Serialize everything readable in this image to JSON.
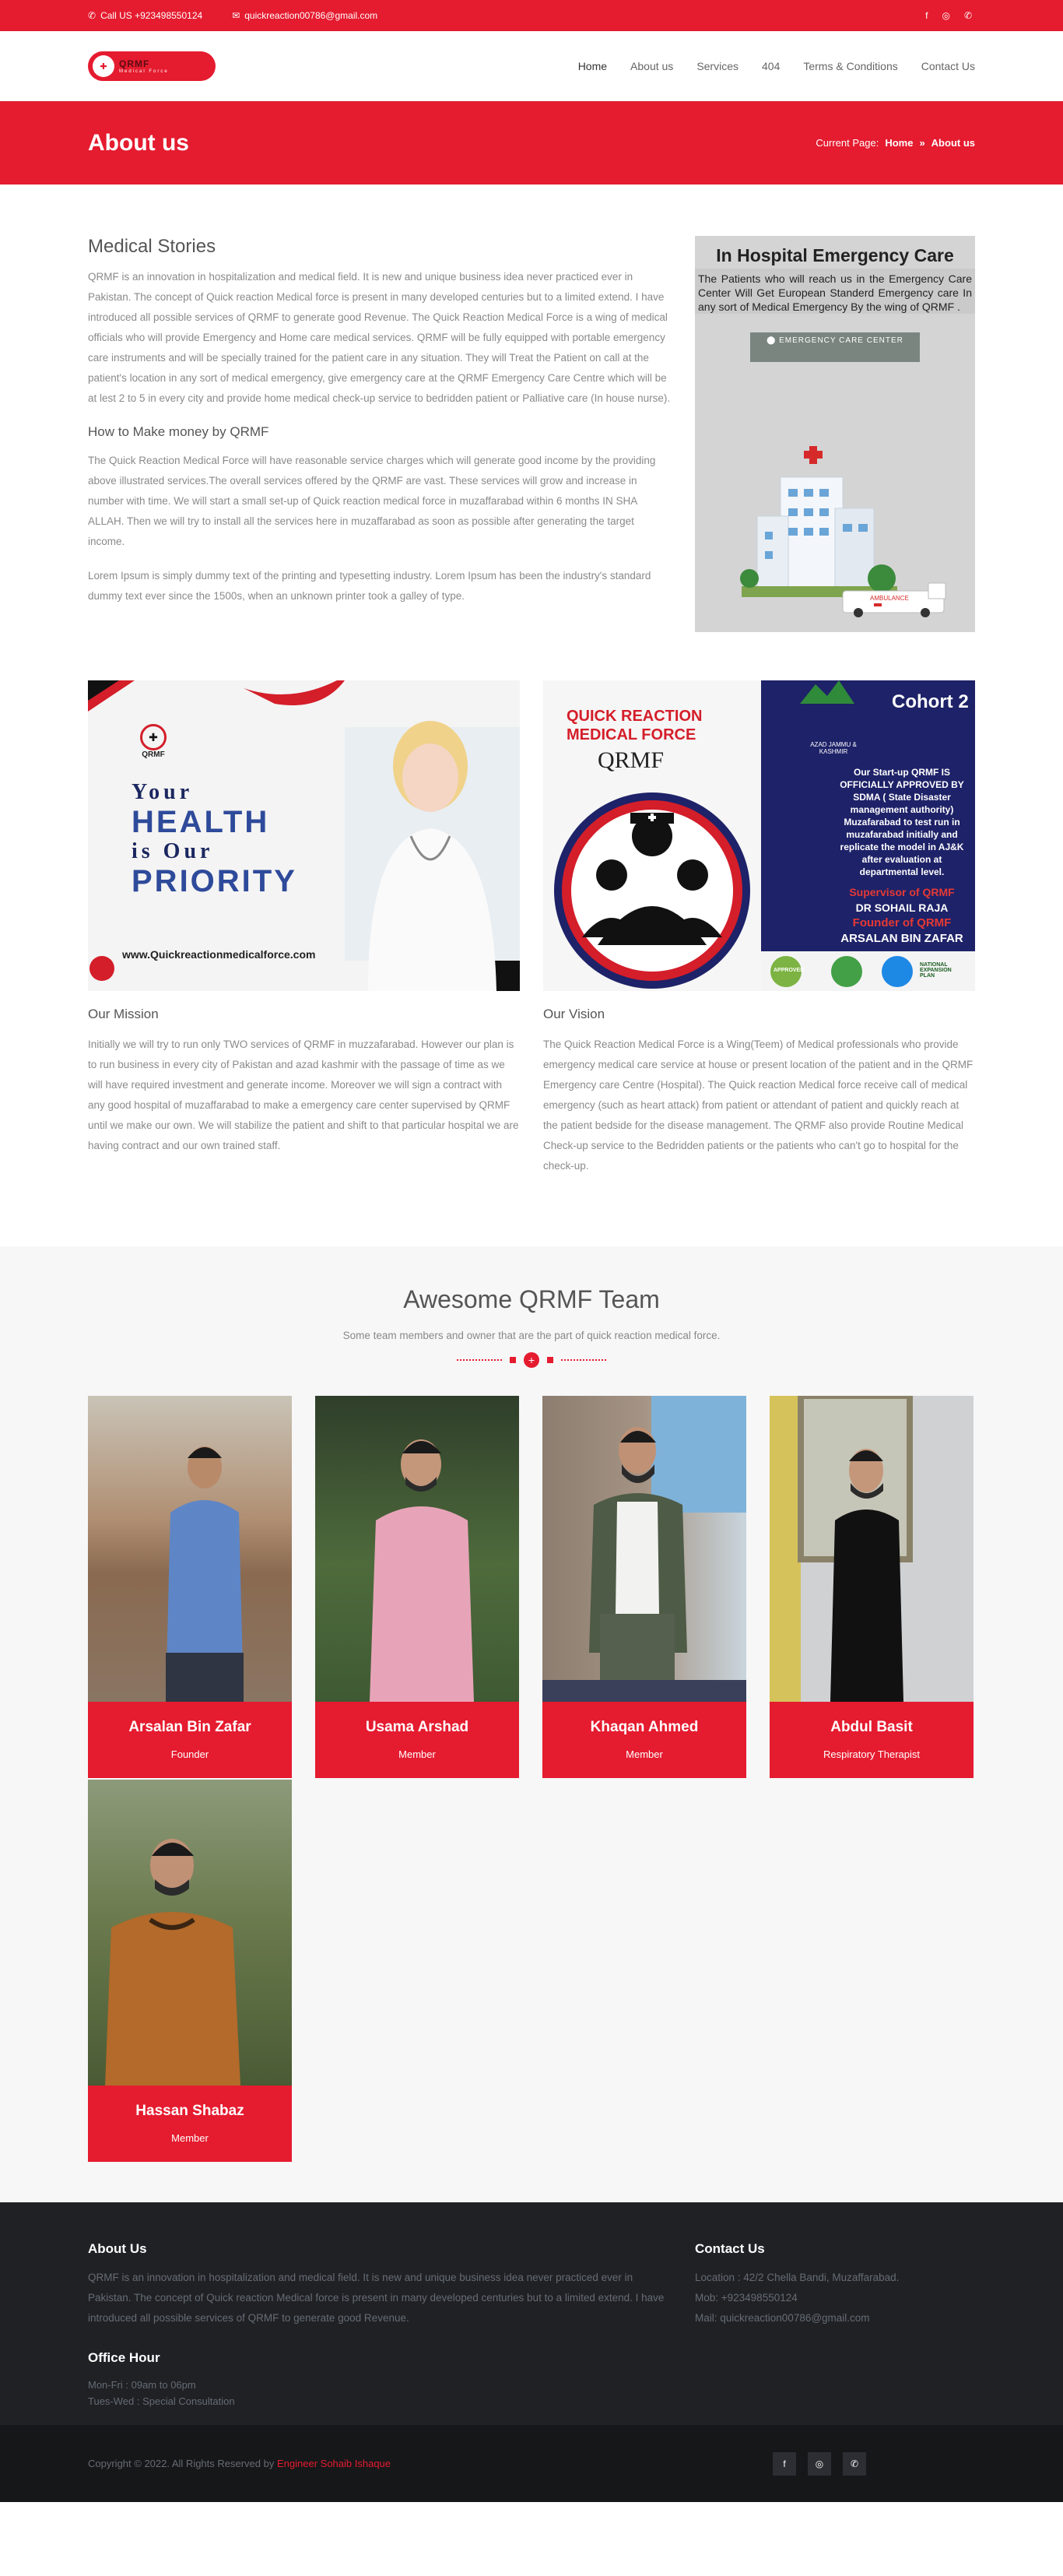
{
  "topbar": {
    "phone": "Call US +923498550124",
    "email": "quickreaction00786@gmail.com",
    "socials": [
      "facebook-icon",
      "instagram-icon",
      "whatsapp-icon"
    ]
  },
  "brand": {
    "color": "#e51b2f",
    "logo_text": "QRMF",
    "logo_sub": "Medical Force"
  },
  "nav": [
    "Home",
    "About us",
    "Services",
    "404",
    "Terms & Conditions",
    "Contact Us"
  ],
  "page_title": {
    "title": "About us",
    "current_label": "Current Page:",
    "crumb_home": "Home",
    "crumb_sep": "»",
    "crumb_current": "About us"
  },
  "stories": {
    "heading": "Medical Stories",
    "p1": "QRMF is an innovation in hospitalization and medical field. It is new and unique business idea never practiced ever in Pakistan. The concept of Quick reaction Medical force is present in many developed centuries but to a limited extend. I have introduced all possible services of QRMF to generate good Revenue. The Quick Reaction Medical Force is a wing of medical officials who will provide Emergency and Home care medical services. QRMF will be fully equipped with portable emergency care instruments and will be specially trained for the patient care in any situation. They will Treat the Patient on call at the patient's location in any sort of medical emergency, give emergency care at the QRMF Emergency Care Centre which will be at lest 2 to 5 in every city and provide home medical check-up service to bedridden patient or Palliative care (In house nurse).",
    "sub": "How to Make money by QRMF",
    "p2": "The Quick Reaction Medical Force will have reasonable service charges which will generate good income by the providing above illustrated services.The overall services offered by the QRMF are vast. These services will grow and increase in number with time. We will start a small set-up of Quick reaction medical force in muzaffarabad within 6 months IN SHA ALLAH. Then we will try to install all the services here in muzaffarabad as soon as possible after generating the target income.",
    "p3": "Lorem Ipsum is simply dummy text of the printing and typesetting industry. Lorem Ipsum has been the industry's standard dummy text ever since the 1500s, when an unknown printer took a galley of type."
  },
  "poster": {
    "title": "In Hospital Emergency Care",
    "text": "The Patients who will reach us in the Emergency Care Center Will Get European Standerd Emergency care In any sort of Medical Emergency By the wing of QRMF .",
    "badge": "EMERGENCY CARE CENTER",
    "ambulance": "AMBULANCE"
  },
  "promo1": {
    "logo": "QRMF",
    "line1": "Your",
    "line2": "HEALTH",
    "line3": "is Our",
    "line4": "PRIORITY",
    "url": "www.Quickreactionmedicalforce.com"
  },
  "promo2": {
    "title1": "QUICK REACTION",
    "title2": "MEDICAL FORCE",
    "logo": "QRMF",
    "cohort": "Cohort 2",
    "region": "AZAD JAMMU & KASHMIR",
    "approval": "Our Start-up QRMF IS OFFICIALLY APPROVED BY SDMA ( State Disaster management authority) Muzafarabad to test run in muzafarabad initially and replicate the model in AJ&K after evaluation at departmental level.",
    "supervisor_label": "Supervisor of QRMF",
    "supervisor": "DR SOHAIL RAJA",
    "founder_label": "Founder of QRMF",
    "founder": "ARSALAN BIN ZAFAR",
    "seal1": "APPROVED",
    "seal2": "NATIONAL EXPANSION PLAN"
  },
  "mission": {
    "heading": "Our Mission",
    "text": "Initially we will try to run only TWO services of QRMF in muzzafarabad. However our plan is to run business in every city of Pakistan and azad kashmir with the passage of time as we will have required investment and generate income. Moreover we will sign a contract with any good hospital of muzaffarabad to make a emergency care center supervised by QRMF until we make our own. We will stabilize the patient and shift to that particular hospital we are having contract and our own trained staff."
  },
  "vision": {
    "heading": "Our Vision",
    "text": "The Quick Reaction Medical Force is a Wing(Teem) of Medical professionals who provide emergency medical care service at house or present location of the patient and in the QRMF Emergency care Centre (Hospital). The Quick reaction Medical force receive call of medical emergency (such as heart attack) from patient or attendant of patient and quickly reach at the patient bedside for the disease management. The QRMF also provide Routine Medical Check-up service to the Bedridden patients or the patients who can't go to hospital for the check-up."
  },
  "team": {
    "heading": "Awesome QRMF Team",
    "lead": "Some team members and owner that are the part of quick reaction medical force.",
    "members": [
      {
        "name": "Arsalan Bin Zafar",
        "role": "Founder"
      },
      {
        "name": "Usama Arshad",
        "role": "Member"
      },
      {
        "name": "Khaqan Ahmed",
        "role": "Member"
      },
      {
        "name": "Abdul Basit",
        "role": "Respiratory Therapist"
      },
      {
        "name": "Hassan Shabaz",
        "role": "Member"
      }
    ]
  },
  "footer": {
    "about_heading": "About Us",
    "about_text": "QRMF is an innovation in hospitalization and medical field. It is new and unique business idea never practiced ever in Pakistan. The concept of Quick reaction Medical force is present in many developed centuries but to a limited extend. I have introduced all possible services of QRMF to generate good Revenue.",
    "hours_heading": "Office Hour",
    "hours1": "Mon-Fri : 09am to 06pm",
    "hours2": "Tues-Wed : Special Consultation",
    "contact_heading": "Contact Us",
    "location": "Location : 42/2 Chella Bandi, Muzaffarabad.",
    "mob": "Mob: +923498550124",
    "mail": "Mail: quickreaction00786@gmail.com"
  },
  "bottombar": {
    "copyright": "Copyright © 2022. All Rights Reserved by",
    "author": "Engineer Sohaib Ishaque"
  }
}
